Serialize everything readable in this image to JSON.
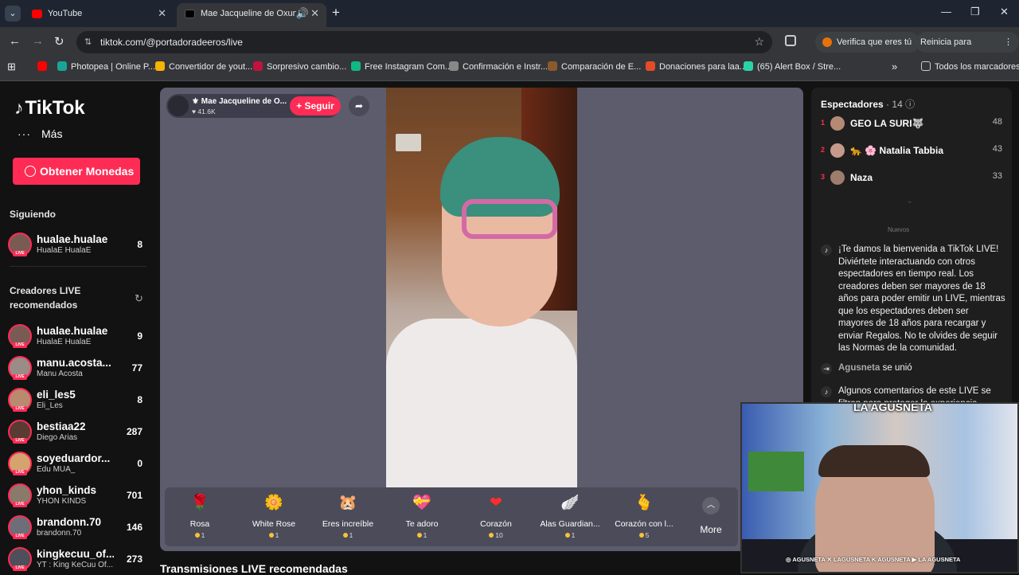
{
  "browser": {
    "tabs": [
      {
        "title": "YouTube",
        "color": "#ff0000"
      },
      {
        "title": "Mae Jacqueline de Oxun",
        "color": "#000000"
      }
    ],
    "url": "tiktok.com/@portadoradeeros/live",
    "verify": "Verifica que eres tú",
    "update": "Reinicia para actualizar",
    "bookmarks": [
      {
        "label": "",
        "color": "#ff0000"
      },
      {
        "label": "Photopea | Online P...",
        "color": "#18a497"
      },
      {
        "label": "Convertidor de yout...",
        "color": "#f5b400"
      },
      {
        "label": "Sorpresivo cambio...",
        "color": "#c0143c"
      },
      {
        "label": "Free Instagram Com...",
        "color": "#10b981"
      },
      {
        "label": "Confirmación e Instr...",
        "color": "#888888"
      },
      {
        "label": "Comparación de E...",
        "color": "#8b5a2b"
      },
      {
        "label": "Donaciones para laa...",
        "color": "#e34c26"
      },
      {
        "label": "(65) Alert Box / Stre...",
        "color": "#2bd4a8"
      }
    ],
    "all_bookmarks": "Todos los marcadores"
  },
  "sidebar": {
    "logo": "TikTok",
    "more": "Más",
    "coins_button": "Obtener Monedas",
    "following_title": "Siguiendo",
    "following": [
      {
        "name": "hualae.hualae",
        "sub": "HualaE HualaE",
        "count": "8"
      }
    ],
    "creators_title_1": "Creadores LIVE",
    "creators_title_2": "recomendados",
    "creators": [
      {
        "name": "hualae.hualae",
        "sub": "HualaE HualaE",
        "count": "9"
      },
      {
        "name": "manu.acosta...",
        "sub": "Manu Acosta",
        "count": "77"
      },
      {
        "name": "eli_les5",
        "sub": "Eli_Les",
        "count": "8"
      },
      {
        "name": "bestiaa22",
        "sub": "Diego Arias",
        "count": "287"
      },
      {
        "name": "soyeduardor...",
        "sub": "Edu MUA_",
        "count": "0"
      },
      {
        "name": "yhon_kinds",
        "sub": "YHON KINDS",
        "count": "701"
      },
      {
        "name": "brandonn.70",
        "sub": "brandonn.70",
        "count": "146"
      },
      {
        "name": "kingkecuu_of...",
        "sub": "YT : King KeCuu Of...",
        "count": "273"
      }
    ]
  },
  "stream": {
    "host_name": "Mae Jacqueline de O...",
    "likes": "41.6K",
    "follow": "+ Seguir",
    "gifts": [
      {
        "name": "Rosa",
        "price": "1",
        "icon": "🌹"
      },
      {
        "name": "White Rose",
        "price": "1",
        "icon": "🌼"
      },
      {
        "name": "Eres increíble",
        "price": "1",
        "icon": "🐹"
      },
      {
        "name": "Te adoro",
        "price": "1",
        "icon": "💝"
      },
      {
        "name": "Corazón",
        "price": "10",
        "icon": "❤"
      },
      {
        "name": "Alas Guardian...",
        "price": "1",
        "icon": "🪽"
      },
      {
        "name": "Corazón con l...",
        "price": "5",
        "icon": "🫰"
      }
    ],
    "more": "More",
    "recommended": "Transmisiones LIVE recomendadas"
  },
  "chat": {
    "title": "Espectadores",
    "count": "14",
    "viewers": [
      {
        "rank": "1",
        "name": "GEO LA SURI🐺",
        "score": "48"
      },
      {
        "rank": "2",
        "name": "🐆 🌸 Natalia Tabbia",
        "score": "43"
      },
      {
        "rank": "3",
        "name": "Naza",
        "score": "33"
      }
    ],
    "new_label": "Nuevos",
    "welcome": "¡Te damos la bienvenida a TikTok LIVE! Diviértete interactuando con otros espectadores en tiempo real. Los creadores deben ser mayores de 18 años para poder emitir un LIVE, mientras que los espectadores deben ser mayores de 18 años para recargar y enviar Regalos. No te olvides de seguir las Normas de la comunidad.",
    "join_user": "Agusneta",
    "join_text": "se unió",
    "filter_msg": "Algunos comentarios de este LIVE se filtran para proteger la experiencia"
  },
  "overlay": {
    "badge": "LA AGUSNETA",
    "social": "◎ AGUSNETA  ✕ LAGUSNETA  K AGUSNETA  ▶ LA AGUSNETA"
  }
}
